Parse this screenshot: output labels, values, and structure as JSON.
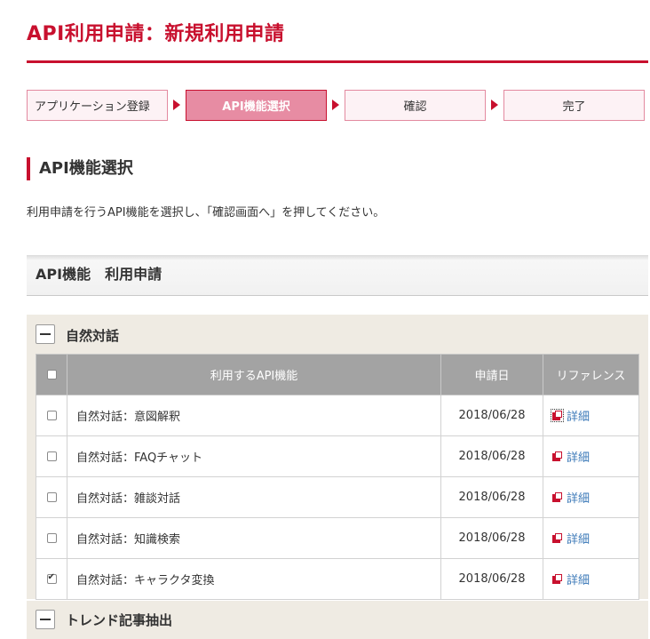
{
  "page_title": "API利用申請：新規利用申請",
  "steps": [
    {
      "label": "アプリケーション登録",
      "state": "done"
    },
    {
      "label": "API機能選択",
      "state": "active"
    },
    {
      "label": "確認",
      "state": "pending"
    },
    {
      "label": "完了",
      "state": "pending"
    }
  ],
  "section_title": "API機能選択",
  "intro_text": "利用申請を行うAPI機能を選択し、「確認画面へ」を押してください。",
  "panel_title": "API機能　利用申請",
  "categories": [
    {
      "title": "自然対話",
      "expanded": true,
      "columns": {
        "feature": "利用するAPI機能",
        "date": "申請日",
        "reference": "リファレンス"
      },
      "rows": [
        {
          "name": "自然対話：意図解釈",
          "date": "2018/06/28",
          "ref": "詳細",
          "checked": false
        },
        {
          "name": "自然対話：FAQチャット",
          "date": "2018/06/28",
          "ref": "詳細",
          "checked": false
        },
        {
          "name": "自然対話：雑談対話",
          "date": "2018/06/28",
          "ref": "詳細",
          "checked": false
        },
        {
          "name": "自然対話：知識検索",
          "date": "2018/06/28",
          "ref": "詳細",
          "checked": false
        },
        {
          "name": "自然対話：キャラクタ変換",
          "date": "2018/06/28",
          "ref": "詳細",
          "checked": true
        }
      ]
    },
    {
      "title": "トレンド記事抽出",
      "expanded": true
    }
  ],
  "colors": {
    "accent": "#c8102e",
    "step_active": "#e78ca3",
    "table_header": "#a3a3a3",
    "category_bg": "#efebe3",
    "link": "#3d7ab8"
  }
}
